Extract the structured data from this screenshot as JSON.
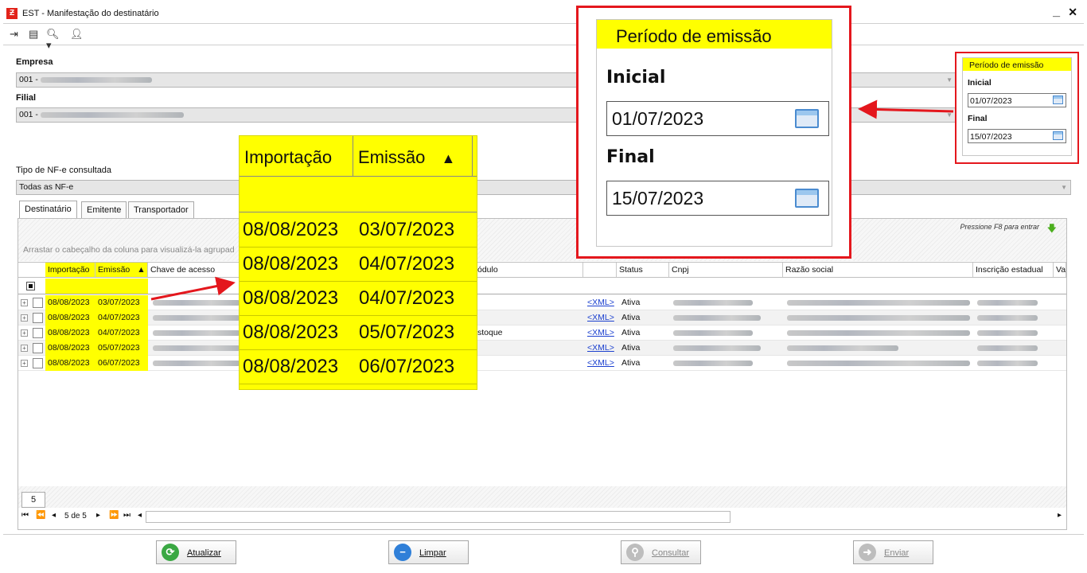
{
  "window": {
    "app_icon": "Ƶ",
    "title": "EST - Manifestação do destinatário",
    "minimize": "_",
    "close": "✕"
  },
  "toolbar": {
    "icons": [
      "exit-icon",
      "card-icon",
      "search-icon",
      "user-icon"
    ]
  },
  "form": {
    "empresa_label": "Empresa",
    "empresa_value": "001 -",
    "filial_label": "Filial",
    "filial_value": "001 -",
    "tipo_label": "Tipo de NF-e consultada",
    "tipo_value": "Todas as NF-e"
  },
  "tabs": [
    "Destinatário",
    "Emitente",
    "Transportador"
  ],
  "grid": {
    "group_hint": "Arrastar o cabeçalho da coluna para visualizá-la agrupad",
    "f8_hint": "Pressione F8 para entrar",
    "columns": [
      "Importação",
      "Emissão",
      "Chave de acesso",
      "ódulo",
      "Status",
      "Cnpj",
      "Razão social",
      "Inscrição estadual",
      "Va"
    ],
    "sort_indicator": "▲",
    "rows": [
      {
        "importacao": "08/08/2023",
        "emissao": "03/07/2023",
        "modulo": "",
        "xml": "<XML>",
        "status": "Ativa"
      },
      {
        "importacao": "08/08/2023",
        "emissao": "04/07/2023",
        "modulo": "",
        "xml": "<XML>",
        "status": "Ativa"
      },
      {
        "importacao": "08/08/2023",
        "emissao": "04/07/2023",
        "modulo": "stoque",
        "xml": "<XML>",
        "status": "Ativa"
      },
      {
        "importacao": "08/08/2023",
        "emissao": "05/07/2023",
        "modulo": "",
        "xml": "<XML>",
        "status": "Ativa"
      },
      {
        "importacao": "08/08/2023",
        "emissao": "06/07/2023",
        "modulo": "",
        "xml": "<XML>",
        "status": "Ativa"
      }
    ],
    "count": "5",
    "nav_position": "5 de 5"
  },
  "buttons": {
    "atualizar": "Atualizar",
    "limpar": "Limpar",
    "consultar": "Consultar",
    "enviar": "Enviar"
  },
  "zoom_grid": {
    "col1": "Importação",
    "col2": "Emissão",
    "rows": [
      [
        "08/08/2023",
        "03/07/2023"
      ],
      [
        "08/08/2023",
        "04/07/2023"
      ],
      [
        "08/08/2023",
        "04/07/2023"
      ],
      [
        "08/08/2023",
        "05/07/2023"
      ],
      [
        "08/08/2023",
        "06/07/2023"
      ]
    ]
  },
  "periodo": {
    "title": "Período de emissão",
    "inicial_label": "Inicial",
    "inicial_value": "01/07/2023",
    "final_label": "Final",
    "final_value": "15/07/2023"
  },
  "colors": {
    "highlight": "#ffff00",
    "callout_border": "#e4171d",
    "link": "#1a3fcf"
  }
}
